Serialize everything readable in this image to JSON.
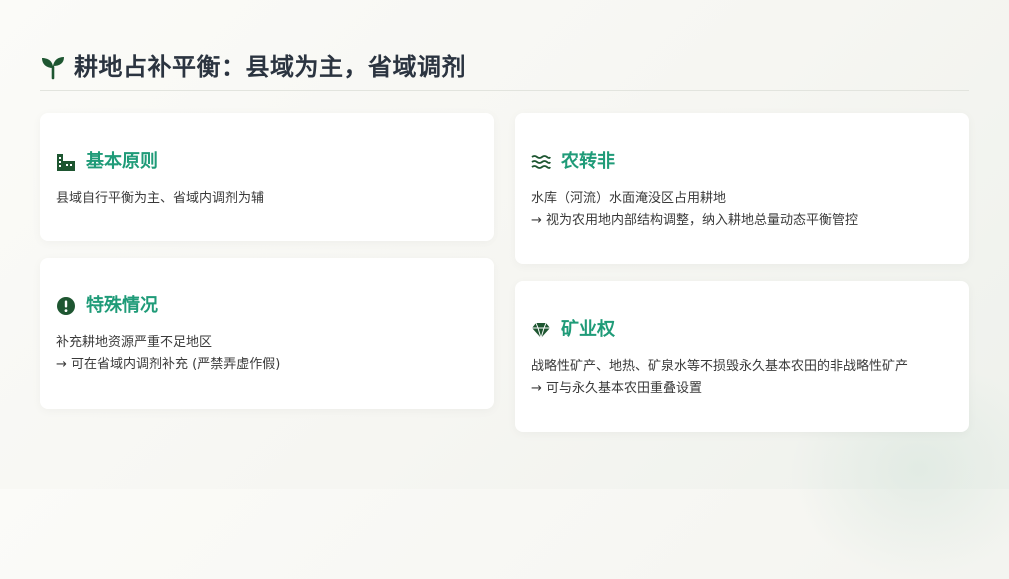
{
  "page": {
    "title": "耕地占补平衡：县域为主，省域调剂",
    "title_icon": "seedling-icon",
    "accent_color": "#1f9b78",
    "icon_color": "#1e5631"
  },
  "cards": {
    "basic": {
      "icon": "building-icon",
      "title": "基本原则",
      "lines": [
        "县域自行平衡为主、省域内调剂为辅"
      ]
    },
    "special": {
      "icon": "exclamation-circle-icon",
      "title": "特殊情况",
      "lines": [
        "补充耕地资源严重不足地区",
        "→ 可在省域内调剂补充 (严禁弄虚作假)"
      ]
    },
    "convert": {
      "icon": "water-icon",
      "title": "农转非",
      "lines": [
        "水库（河流）水面淹没区占用耕地",
        "→ 视为农用地内部结构调整，纳入耕地总量动态平衡管控"
      ]
    },
    "mining": {
      "icon": "gem-icon",
      "title": "矿业权",
      "lines": [
        "战略性矿产、地热、矿泉水等不损毁永久基本农田的非战略性矿产",
        "→ 可与永久基本农田重叠设置"
      ]
    }
  }
}
